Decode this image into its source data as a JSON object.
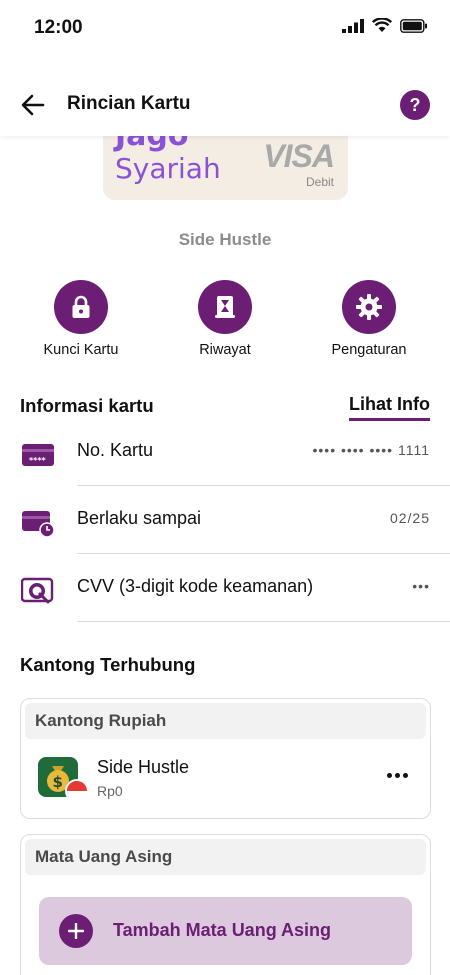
{
  "status_bar": {
    "time": "12:00"
  },
  "header": {
    "title": "Rincian Kartu",
    "help_label": "?"
  },
  "card": {
    "brand_top": "Jago",
    "brand_bottom": "Syariah",
    "network": "VISA",
    "type": "Debit"
  },
  "pocket_name": "Side Hustle",
  "actions": [
    {
      "label": "Kunci Kartu",
      "icon": "lock-icon"
    },
    {
      "label": "Riwayat",
      "icon": "history-icon"
    },
    {
      "label": "Pengaturan",
      "icon": "gear-icon"
    }
  ],
  "info": {
    "title": "Informasi kartu",
    "link": "Lihat Info",
    "rows": [
      {
        "label": "No. Kartu",
        "value": "•••• •••• •••• 1111",
        "icon": "card-number-icon"
      },
      {
        "label": "Berlaku sampai",
        "value": "02/25",
        "icon": "card-expiry-icon"
      },
      {
        "label": "CVV (3-digit kode keamanan)",
        "value": "•••",
        "icon": "cvv-icon"
      }
    ]
  },
  "linked": {
    "title": "Kantong Terhubung",
    "rupiah": {
      "header": "Kantong Rupiah",
      "item": {
        "name": "Side Hustle",
        "balance": "Rp0"
      }
    },
    "foreign": {
      "header": "Mata Uang Asing",
      "add_label": "Tambah Mata Uang Asing"
    }
  },
  "colors": {
    "primary": "#6b1e74",
    "accent_light": "#dcc9de",
    "card_bg": "#f4ede3"
  }
}
